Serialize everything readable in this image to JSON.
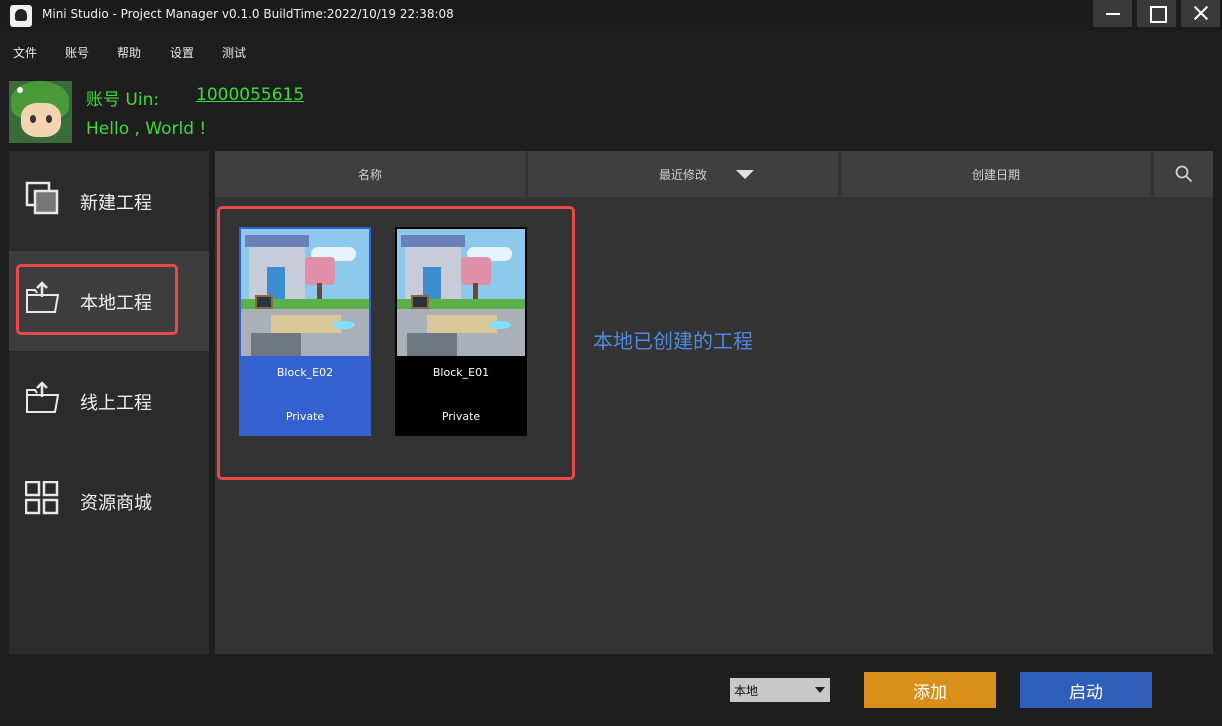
{
  "window": {
    "title": "Mini Studio - Project Manager v0.1.0 BuildTime:2022/10/19 22:38:08"
  },
  "menu": [
    "文件",
    "账号",
    "帮助",
    "设置",
    "测试"
  ],
  "account": {
    "label": "账号 Uin:",
    "uin": "1000055615",
    "greeting": "Hello , World !"
  },
  "sidebar": {
    "items": [
      {
        "label": "新建工程",
        "icon": "new-project-icon"
      },
      {
        "label": "本地工程",
        "icon": "folder-upload-icon",
        "active": true
      },
      {
        "label": "线上工程",
        "icon": "folder-upload-icon"
      },
      {
        "label": "资源商城",
        "icon": "grid-icon"
      }
    ]
  },
  "table": {
    "columns": [
      "名称",
      "最近修改",
      "创建日期"
    ],
    "sort_column": "最近修改",
    "search_icon": "search-icon"
  },
  "projects": [
    {
      "name": "Block_E02",
      "status": "Private",
      "selected": true
    },
    {
      "name": "Block_E01",
      "status": "Private",
      "selected": false
    }
  ],
  "annotation": "本地已创建的工程",
  "footer": {
    "location_select": "本地",
    "add_label": "添加",
    "launch_label": "启动"
  },
  "colors": {
    "accent_green": "#3ddb3d",
    "highlight_red": "#e84a4a",
    "selected_blue": "#3560d0",
    "add_orange": "#d9901a",
    "launch_blue": "#2f5fb8",
    "caption_blue": "#4f8ae0"
  }
}
